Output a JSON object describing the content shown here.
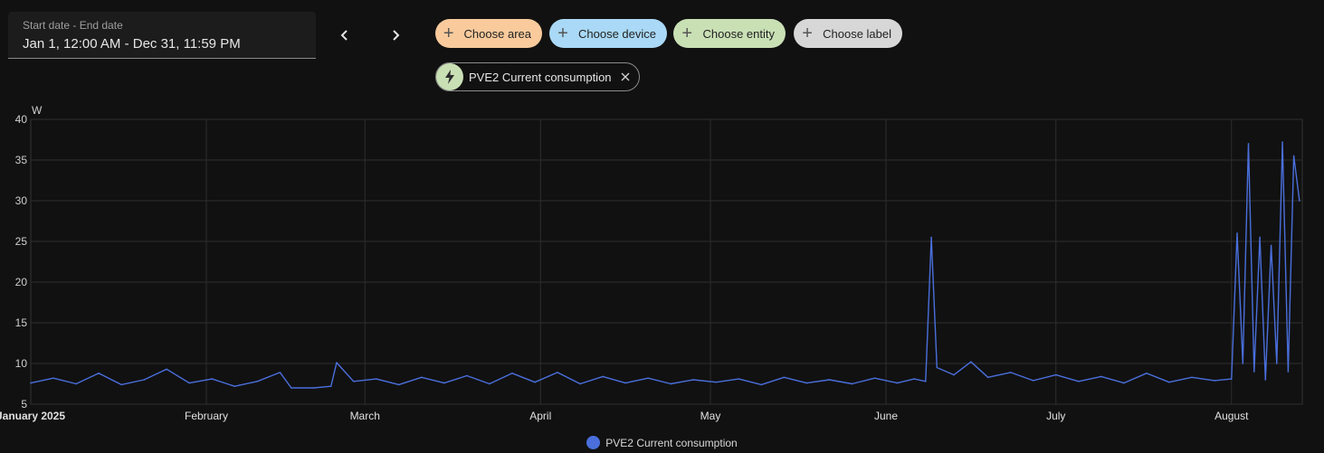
{
  "date_range": {
    "label": "Start date - End date",
    "value": "Jan 1, 12:00 AM - Dec 31, 11:59 PM"
  },
  "nav": {
    "prev_icon": "chevron-left-icon",
    "next_icon": "chevron-right-icon"
  },
  "pickers": {
    "area": {
      "label": "Choose area",
      "color": "#f8ca9c"
    },
    "device": {
      "label": "Choose device",
      "color": "#a9d9f6"
    },
    "entity": {
      "label": "Choose entity",
      "color": "#c9e0b5"
    },
    "label": {
      "label": "Choose label",
      "color": "#d7d7d7"
    }
  },
  "selected_entity": {
    "name": "PVE2 Current consumption",
    "icon": "lightning-bolt-icon",
    "remove_icon": "close-icon"
  },
  "chart_data": {
    "type": "line",
    "unit": "W",
    "ylim": [
      5,
      40
    ],
    "yticks": [
      5,
      10,
      15,
      20,
      25,
      30,
      35,
      40
    ],
    "xlim": [
      "2025-01-01",
      "2025-08-13"
    ],
    "xticks": [
      {
        "date": "2025-01-01",
        "label": "January 2025"
      },
      {
        "date": "2025-02-01",
        "label": "February"
      },
      {
        "date": "2025-03-01",
        "label": "March"
      },
      {
        "date": "2025-04-01",
        "label": "April"
      },
      {
        "date": "2025-05-01",
        "label": "May"
      },
      {
        "date": "2025-06-01",
        "label": "June"
      },
      {
        "date": "2025-07-01",
        "label": "July"
      },
      {
        "date": "2025-08-01",
        "label": "August"
      }
    ],
    "grid": true,
    "legend_position": "bottom",
    "series": [
      {
        "name": "PVE2 Current consumption",
        "color": "#4a6fdc",
        "points": [
          [
            "2025-01-01",
            7.6
          ],
          [
            "2025-01-05",
            8.2
          ],
          [
            "2025-01-09",
            7.5
          ],
          [
            "2025-01-13",
            8.8
          ],
          [
            "2025-01-17",
            7.4
          ],
          [
            "2025-01-21",
            8.0
          ],
          [
            "2025-01-25",
            9.3
          ],
          [
            "2025-01-29",
            7.6
          ],
          [
            "2025-02-02",
            8.1
          ],
          [
            "2025-02-06",
            7.2
          ],
          [
            "2025-02-10",
            7.8
          ],
          [
            "2025-02-14",
            8.9
          ],
          [
            "2025-02-16",
            7.0
          ],
          [
            "2025-02-20",
            7.0
          ],
          [
            "2025-02-23",
            7.2
          ],
          [
            "2025-02-24",
            10.1
          ],
          [
            "2025-02-27",
            7.8
          ],
          [
            "2025-03-03",
            8.1
          ],
          [
            "2025-03-07",
            7.4
          ],
          [
            "2025-03-11",
            8.3
          ],
          [
            "2025-03-15",
            7.6
          ],
          [
            "2025-03-19",
            8.5
          ],
          [
            "2025-03-23",
            7.5
          ],
          [
            "2025-03-27",
            8.8
          ],
          [
            "2025-03-31",
            7.7
          ],
          [
            "2025-04-04",
            8.9
          ],
          [
            "2025-04-08",
            7.5
          ],
          [
            "2025-04-12",
            8.4
          ],
          [
            "2025-04-16",
            7.6
          ],
          [
            "2025-04-20",
            8.2
          ],
          [
            "2025-04-24",
            7.5
          ],
          [
            "2025-04-28",
            8.0
          ],
          [
            "2025-05-02",
            7.7
          ],
          [
            "2025-05-06",
            8.1
          ],
          [
            "2025-05-10",
            7.4
          ],
          [
            "2025-05-14",
            8.3
          ],
          [
            "2025-05-18",
            7.6
          ],
          [
            "2025-05-22",
            8.0
          ],
          [
            "2025-05-26",
            7.5
          ],
          [
            "2025-05-30",
            8.2
          ],
          [
            "2025-06-03",
            7.6
          ],
          [
            "2025-06-06",
            8.1
          ],
          [
            "2025-06-08",
            7.8
          ],
          [
            "2025-06-09",
            25.5
          ],
          [
            "2025-06-10",
            9.5
          ],
          [
            "2025-06-13",
            8.6
          ],
          [
            "2025-06-16",
            10.2
          ],
          [
            "2025-06-19",
            8.3
          ],
          [
            "2025-06-23",
            8.9
          ],
          [
            "2025-06-27",
            7.9
          ],
          [
            "2025-07-01",
            8.6
          ],
          [
            "2025-07-05",
            7.8
          ],
          [
            "2025-07-09",
            8.4
          ],
          [
            "2025-07-13",
            7.6
          ],
          [
            "2025-07-17",
            8.8
          ],
          [
            "2025-07-21",
            7.7
          ],
          [
            "2025-07-25",
            8.3
          ],
          [
            "2025-07-29",
            7.9
          ],
          [
            "2025-08-01",
            8.1
          ],
          [
            "2025-08-02",
            26.0
          ],
          [
            "2025-08-03",
            10.0
          ],
          [
            "2025-08-04",
            37.0
          ],
          [
            "2025-08-05",
            9.0
          ],
          [
            "2025-08-06",
            25.5
          ],
          [
            "2025-08-07",
            8.0
          ],
          [
            "2025-08-08",
            24.5
          ],
          [
            "2025-08-09",
            10.0
          ],
          [
            "2025-08-10",
            37.2
          ],
          [
            "2025-08-11",
            9.0
          ],
          [
            "2025-08-12",
            35.5
          ],
          [
            "2025-08-13",
            30.0
          ]
        ]
      }
    ]
  }
}
